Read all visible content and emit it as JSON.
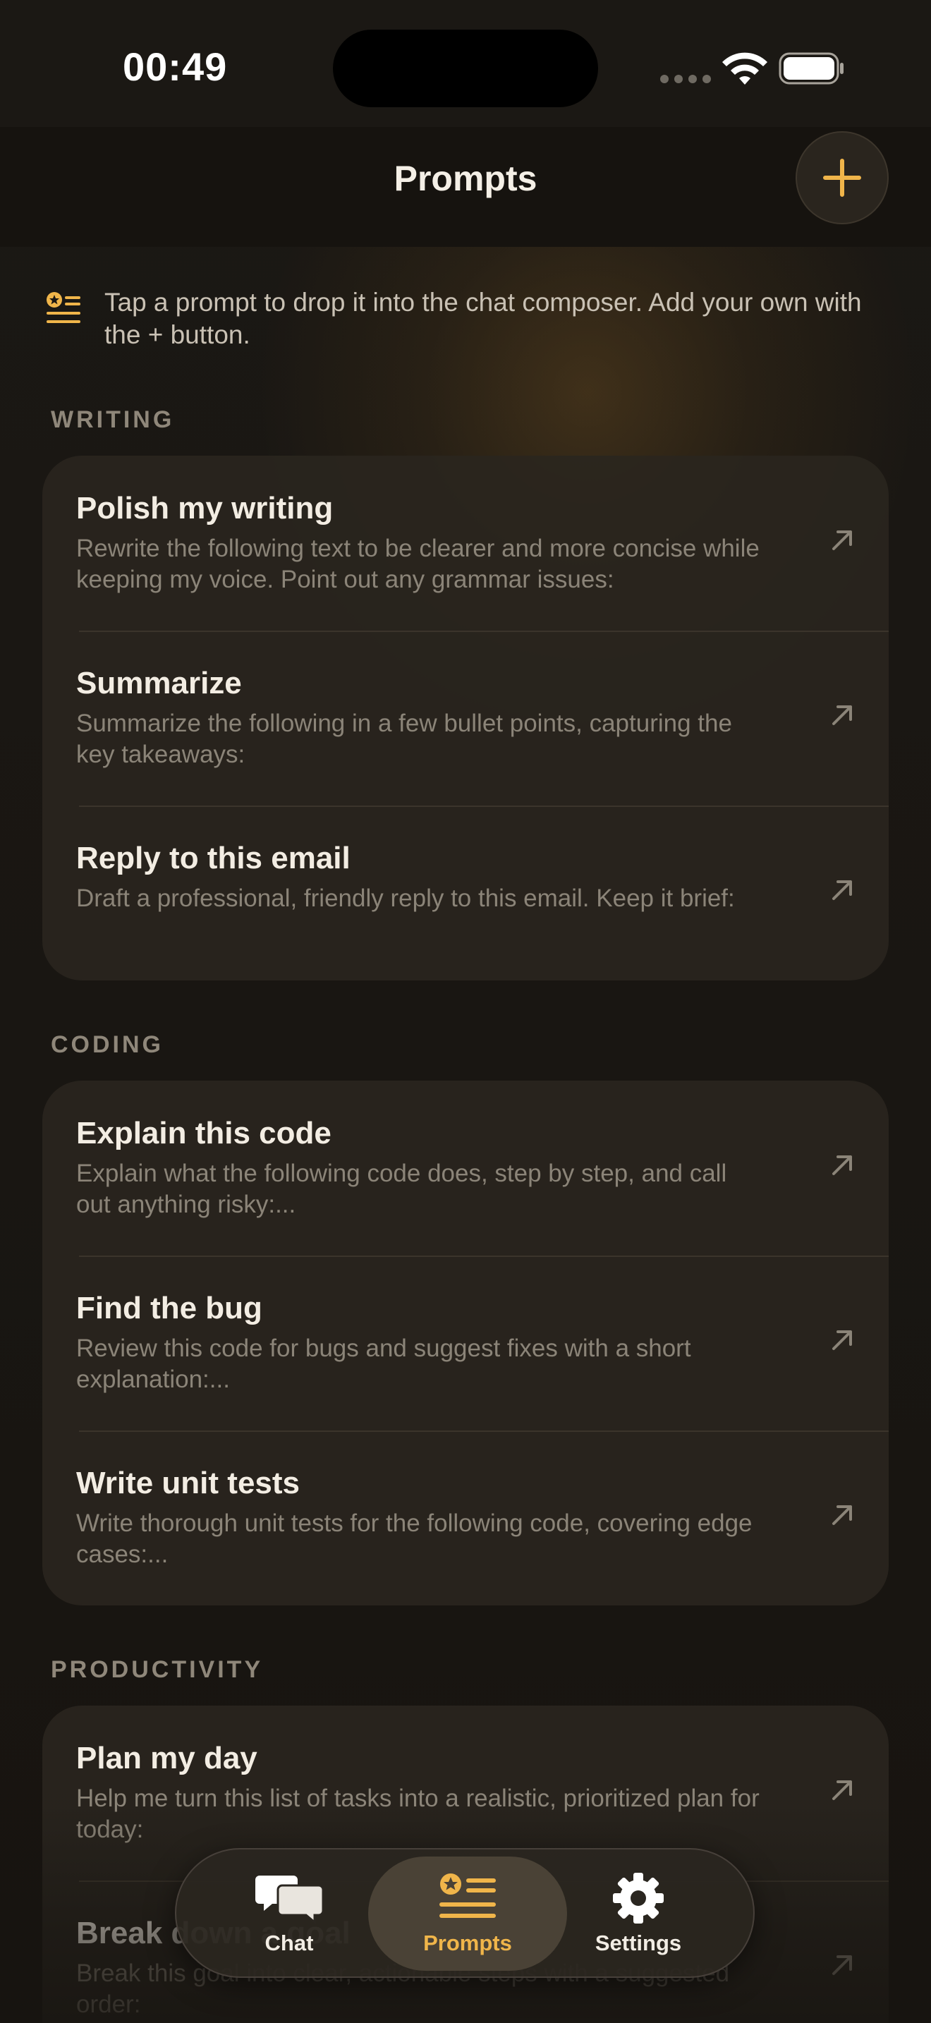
{
  "status": {
    "time": "00:49"
  },
  "header": {
    "title": "Prompts",
    "add_icon": "plus-icon"
  },
  "hint": {
    "icon": "list-star-icon",
    "text": "Tap a prompt to drop it into the chat composer. Add your own with the + button."
  },
  "sections": [
    {
      "label": "WRITING",
      "items": [
        {
          "title": "Polish my writing",
          "desc": "Rewrite the following text to be clearer and more concise while keeping my voice. Point out any grammar issues:"
        },
        {
          "title": "Summarize",
          "desc": "Summarize the following in a few bullet points, capturing the key takeaways:"
        },
        {
          "title": "Reply to this email",
          "desc": "Draft a professional, friendly reply to this email. Keep it brief:"
        }
      ]
    },
    {
      "label": "CODING",
      "items": [
        {
          "title": "Explain this code",
          "desc": "Explain what the following code does, step by step, and call out anything risky:..."
        },
        {
          "title": "Find the bug",
          "desc": "Review this code for bugs and suggest fixes with a short explanation:..."
        },
        {
          "title": "Write unit tests",
          "desc": "Write thorough unit tests for the following code, covering edge cases:..."
        }
      ]
    },
    {
      "label": "PRODUCTIVITY",
      "items": [
        {
          "title": "Plan my day",
          "desc": "Help me turn this list of tasks into a realistic, prioritized plan for today:"
        },
        {
          "title": "Break down a goal",
          "desc": "Break this goal into clear, actionable steps with a suggested order:"
        }
      ]
    }
  ],
  "tabbar": {
    "chat": "Chat",
    "prompts": "Prompts",
    "settings": "Settings"
  },
  "colors": {
    "accent": "#f0b54a",
    "background": "#17140f",
    "card": "#2a251f"
  }
}
